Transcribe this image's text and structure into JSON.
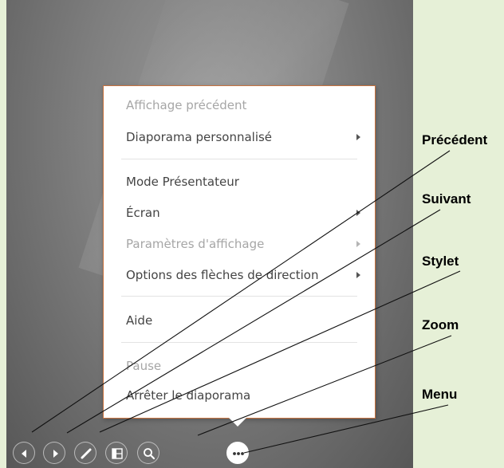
{
  "menu": {
    "items": [
      {
        "label": "Affichage précédent",
        "disabled": true
      },
      {
        "label": "Diaporama personnalisé",
        "submenu": true
      },
      {
        "label": "Mode Présentateur"
      },
      {
        "label": "Écran",
        "submenu": true
      },
      {
        "label": "Paramètres d'affichage",
        "disabled": true,
        "submenu": true
      },
      {
        "label": "Options des flèches de direction",
        "submenu": true
      },
      {
        "label": "Aide"
      },
      {
        "label": "Pause",
        "disabled": true
      },
      {
        "label": "Arrêter le diaporama"
      }
    ]
  },
  "controls": [
    {
      "name": "previous-button",
      "icon": "triangle-left-icon"
    },
    {
      "name": "next-button",
      "icon": "triangle-right-icon"
    },
    {
      "name": "pen-button",
      "icon": "pen-icon"
    },
    {
      "name": "slides-button",
      "icon": "slides-grid-icon"
    },
    {
      "name": "zoom-button",
      "icon": "magnifier-icon"
    },
    {
      "name": "menu-button",
      "icon": "more-dots-icon"
    }
  ],
  "callouts": {
    "precedent": "Précédent",
    "suivant": "Suivant",
    "stylet": "Stylet",
    "zoom": "Zoom",
    "menu": "Menu"
  },
  "colors": {
    "panel_background": "#e6f0d7",
    "menu_border": "#c9733f",
    "menu_text": "#444444",
    "menu_disabled_text": "#a6a6a6"
  }
}
